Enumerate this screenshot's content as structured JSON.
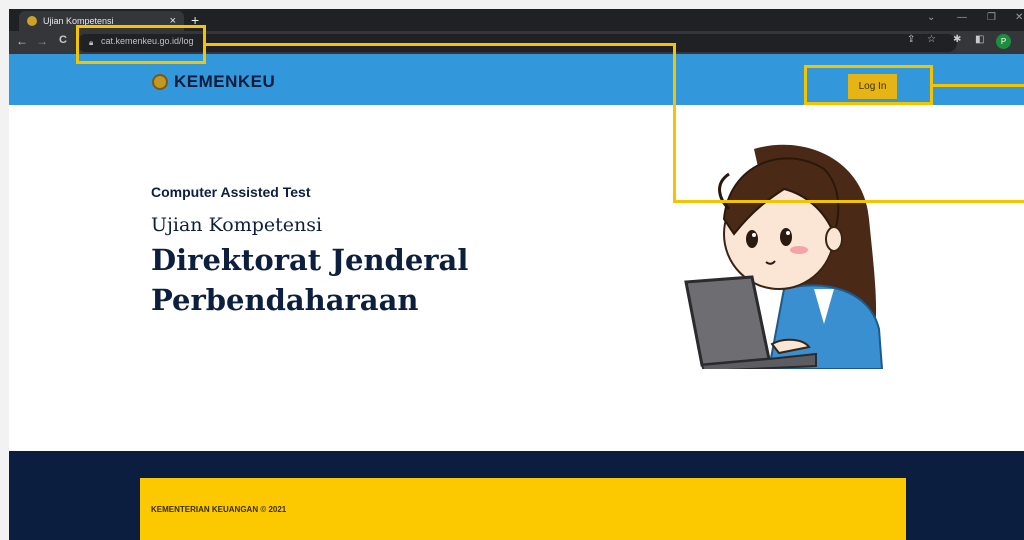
{
  "browser": {
    "tab_title": "Ujian Kompetensi",
    "tab_close": "×",
    "new_tab": "+",
    "url": "cat.kemenkeu.go.id/log",
    "nav": {
      "back": "←",
      "forward": "→",
      "reload": "C"
    },
    "profile_initial": "P"
  },
  "navbar": {
    "brand": "KEMENKEU",
    "login_label": "Log In"
  },
  "hero": {
    "eyebrow": "Computer Assisted Test",
    "subtitle": "Ujian Kompetensi",
    "title_line1": "Direktorat Jenderal",
    "title_line2": "Perbendaharaan"
  },
  "footer": {
    "copyright": "KEMENTERIAN KEUANGAN © 2021"
  },
  "colors": {
    "navbar": "#3397dc",
    "login_button": "#e7b415",
    "footer_bg": "#0b1e3f",
    "footer_card": "#fcc901",
    "annotation": "#f5c400"
  }
}
